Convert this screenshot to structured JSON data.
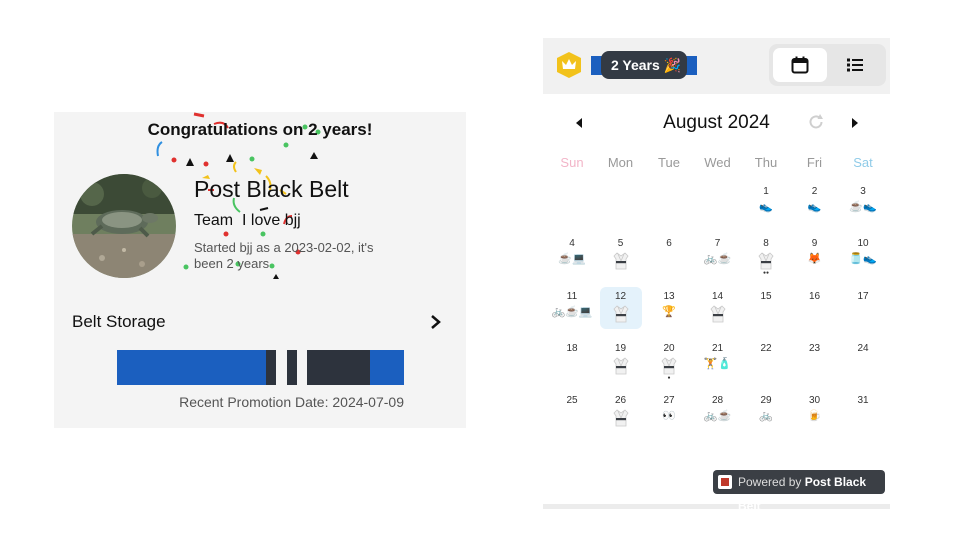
{
  "profile": {
    "congrats": "Congratulations on 2 years!",
    "name": "Post Black Belt",
    "team_line": "Team  I love bjj",
    "started_line": "Started bjj as a 2023-02-02, it's been 2 years",
    "belt_storage_label": "Belt Storage",
    "belt_colors": {
      "base": "#1b5fbf",
      "bar": "#2d333d"
    },
    "promotion": "Recent Promotion Date: 2024-07-09"
  },
  "calendar": {
    "badge": {
      "years_label": "2 Years",
      "emoji": "🎉"
    },
    "view_toggle": {
      "active": "calendar",
      "options": [
        "calendar-icon",
        "list-icon"
      ]
    },
    "month_title": "August 2024",
    "weekdays": [
      "Sun",
      "Mon",
      "Tue",
      "Wed",
      "Thu",
      "Fri",
      "Sat"
    ],
    "weekday_colors": {
      "sun": "#f2b5c8",
      "sat": "#8fcbe8",
      "default": "#999999"
    },
    "selected_day": "12",
    "days": [
      {
        "d": "1",
        "i": [
          "shoe"
        ]
      },
      {
        "d": "2",
        "i": [
          "shoe"
        ]
      },
      {
        "d": "3",
        "i": [
          "coffee",
          "shoe"
        ]
      },
      {
        "d": "4",
        "i": [
          "coffee",
          "laptop"
        ]
      },
      {
        "d": "5",
        "i": [
          "gi"
        ]
      },
      {
        "d": "6",
        "i": []
      },
      {
        "d": "7",
        "i": [
          "bike",
          "coffee"
        ]
      },
      {
        "d": "8",
        "i": [
          "gi"
        ],
        "sub": "●●"
      },
      {
        "d": "9",
        "i": [
          "fox"
        ]
      },
      {
        "d": "10",
        "i": [
          "jar",
          "shoe"
        ]
      },
      {
        "d": "11",
        "i": [
          "bike",
          "coffee",
          "laptop"
        ]
      },
      {
        "d": "12",
        "i": [
          "gi"
        ]
      },
      {
        "d": "13",
        "i": [
          "trophy"
        ]
      },
      {
        "d": "14",
        "i": [
          "gi"
        ]
      },
      {
        "d": "15",
        "i": []
      },
      {
        "d": "16",
        "i": []
      },
      {
        "d": "17",
        "i": []
      },
      {
        "d": "18",
        "i": []
      },
      {
        "d": "19",
        "i": [
          "gi"
        ]
      },
      {
        "d": "20",
        "i": [
          "gi"
        ],
        "sub": "●"
      },
      {
        "d": "21",
        "i": [
          "dumbbell",
          "bottle"
        ]
      },
      {
        "d": "22",
        "i": []
      },
      {
        "d": "23",
        "i": []
      },
      {
        "d": "24",
        "i": []
      },
      {
        "d": "25",
        "i": []
      },
      {
        "d": "26",
        "i": [
          "gi"
        ]
      },
      {
        "d": "27",
        "i": [
          "eyes"
        ]
      },
      {
        "d": "28",
        "i": [
          "bike",
          "coffee"
        ]
      },
      {
        "d": "29",
        "i": [
          "bike"
        ]
      },
      {
        "d": "30",
        "i": [
          "beer"
        ]
      },
      {
        "d": "31",
        "i": []
      }
    ],
    "icon_glyphs": {
      "shoe": "👟",
      "coffee": "☕",
      "laptop": "💻",
      "bike": "🚲",
      "fox": "🦊",
      "jar": "🫙",
      "trophy": "🏆",
      "dumbbell": "🏋",
      "bottle": "🧴",
      "eyes": "👀",
      "beer": "🍺"
    },
    "powered": {
      "prefix": "Powered by ",
      "brand": "Post Black Belt"
    }
  }
}
